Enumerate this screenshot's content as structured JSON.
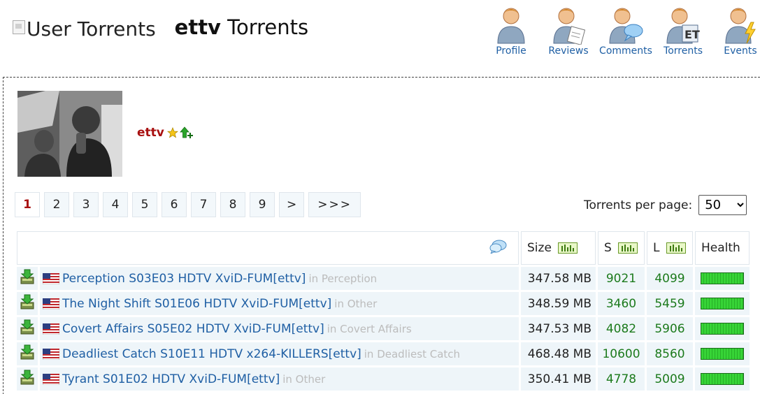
{
  "header": {
    "title_image_alt": "User Torrents",
    "site_title_bold": "ettv",
    "site_title_rest": " Torrents"
  },
  "nav": [
    {
      "label": "Profile",
      "icon": "profile-icon"
    },
    {
      "label": "Reviews",
      "icon": "reviews-icon"
    },
    {
      "label": "Comments",
      "icon": "comments-icon"
    },
    {
      "label": "Torrents",
      "icon": "torrents-icon"
    },
    {
      "label": "Events",
      "icon": "events-icon"
    }
  ],
  "user": {
    "name": "ettv",
    "badges": [
      "star-icon",
      "uploader-icon"
    ]
  },
  "pagination": {
    "pages": [
      "1",
      "2",
      "3",
      "4",
      "5",
      "6",
      "7",
      "8",
      "9"
    ],
    "active": "1",
    "next": ">",
    "last": ">>>"
  },
  "per_page": {
    "label": "Torrents per page:",
    "value": "50"
  },
  "table": {
    "headers": {
      "size": "Size",
      "seeders": "S",
      "leechers": "L",
      "health": "Health"
    },
    "rows": [
      {
        "name": "Perception S03E03 HDTV XviD-FUM[ettv]",
        "category": "in Perception",
        "size": "347.58 MB",
        "seeders": "9021",
        "leechers": "4099",
        "health": 1.0
      },
      {
        "name": "The Night Shift S01E06 HDTV XviD-FUM[ettv]",
        "category": "in Other",
        "size": "348.59 MB",
        "seeders": "3460",
        "leechers": "5459",
        "health": 1.0
      },
      {
        "name": "Covert Affairs S05E02 HDTV XviD-FUM[ettv]",
        "category": "in Covert Affairs",
        "size": "347.53 MB",
        "seeders": "4082",
        "leechers": "5906",
        "health": 1.0
      },
      {
        "name": "Deadliest Catch S10E11 HDTV x264-KILLERS[ettv]",
        "category": "in Deadliest Catch",
        "size": "468.48 MB",
        "seeders": "10600",
        "leechers": "8560",
        "health": 1.0
      },
      {
        "name": "Tyrant S01E02 HDTV XviD-FUM[ettv]",
        "category": "in Other",
        "size": "350.41 MB",
        "seeders": "4778",
        "leechers": "5009",
        "health": 1.0
      }
    ]
  }
}
